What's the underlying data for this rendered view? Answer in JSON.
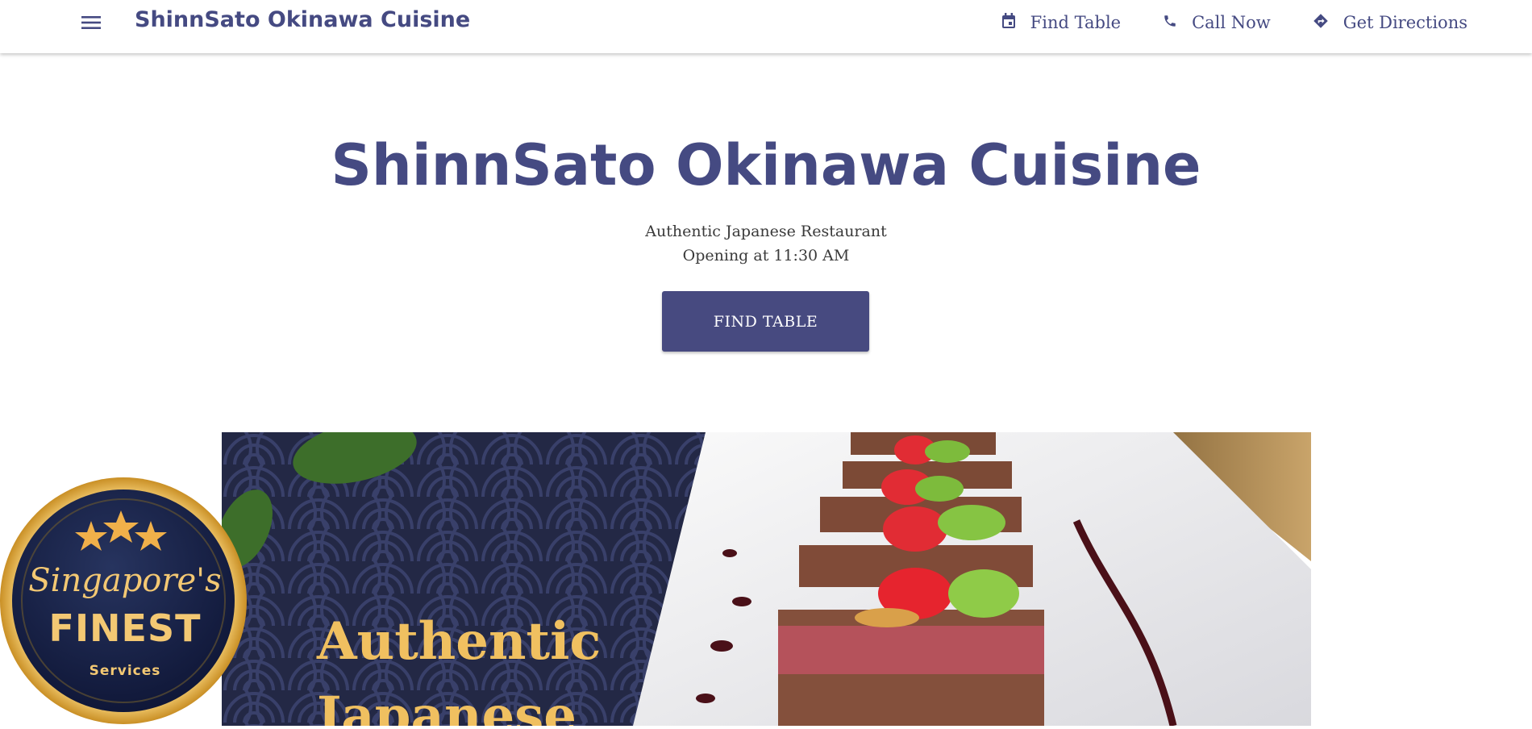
{
  "header": {
    "brand": "ShinnSato Okinawa Cuisine",
    "nav": [
      {
        "label": "Find Table",
        "icon": "calendar-icon"
      },
      {
        "label": "Call Now",
        "icon": "phone-icon"
      },
      {
        "label": "Get Directions",
        "icon": "directions-icon"
      }
    ]
  },
  "hero": {
    "title": "ShinnSato Okinawa Cuisine",
    "subtitle": "Authentic Japanese Restaurant",
    "hours": "Opening at 11:30 AM",
    "cta_label": "FIND TABLE"
  },
  "banner": {
    "text": "Authentic\nJapanese"
  },
  "badge": {
    "script": "Singapore's",
    "main": "FINEST",
    "sub": "Services"
  },
  "colors": {
    "brand": "#454a82",
    "button": "#474a80",
    "banner_navy": "#232845",
    "gold": "#f0c060"
  }
}
